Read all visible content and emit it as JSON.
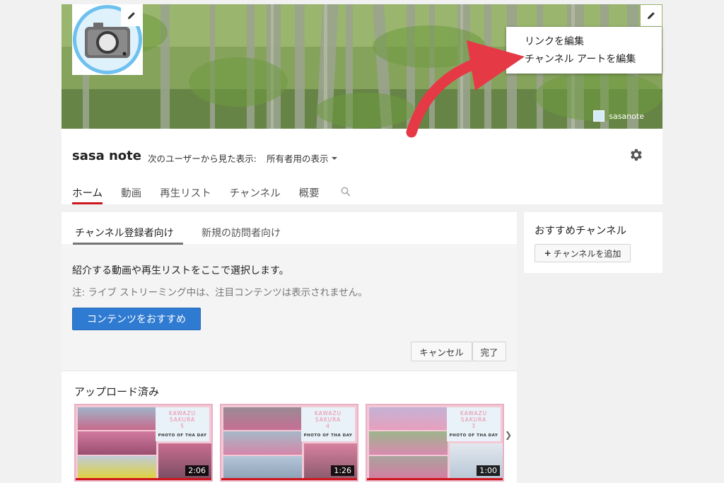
{
  "banner": {
    "link_label": "sasanote",
    "menu": [
      "リンクを編集",
      "チャンネル アートを編集"
    ]
  },
  "channel": {
    "title": "sasa note",
    "view_as_label": "次のユーザーから見た表示:",
    "view_as_value": "所有者用の表示"
  },
  "nav": {
    "tabs": [
      "ホーム",
      "動画",
      "再生リスト",
      "チャンネル",
      "概要"
    ],
    "active_index": 0
  },
  "main": {
    "subtabs": [
      "チャンネル登録者向け",
      "新規の訪問者向け"
    ],
    "feature_text": "紹介する動画や再生リストをここで選択します。",
    "feature_note": "注: ライブ ストリーミング中は、注目コンテンツは表示されません。",
    "recommend_button": "コンテンツをおすすめ",
    "cancel_button": "キャンセル",
    "done_button": "完了",
    "uploads_title": "アップロード済み",
    "videos": [
      {
        "logo_line1": "KAWAZU",
        "logo_line2": "SAKURA",
        "logo_num": "5",
        "logo_caption": "PHOTO OF THA DAY",
        "duration": "2:06"
      },
      {
        "logo_line1": "KAWAZU",
        "logo_line2": "SAKURA",
        "logo_num": "4",
        "logo_caption": "PHOTO OF THA DAY",
        "duration": "1:26"
      },
      {
        "logo_line1": "KAWAZU",
        "logo_line2": "SAKURA",
        "logo_num": "3",
        "logo_caption": "PHOTO OF THA DAY",
        "duration": "1:00"
      }
    ]
  },
  "sidebar": {
    "title": "おすすめチャンネル",
    "add_button": "チャンネルを追加",
    "add_symbol": "+"
  },
  "colors": {
    "accent_red": "#cc181e",
    "button_blue": "#2f7bd2",
    "annotation_arrow": "#e53946"
  }
}
